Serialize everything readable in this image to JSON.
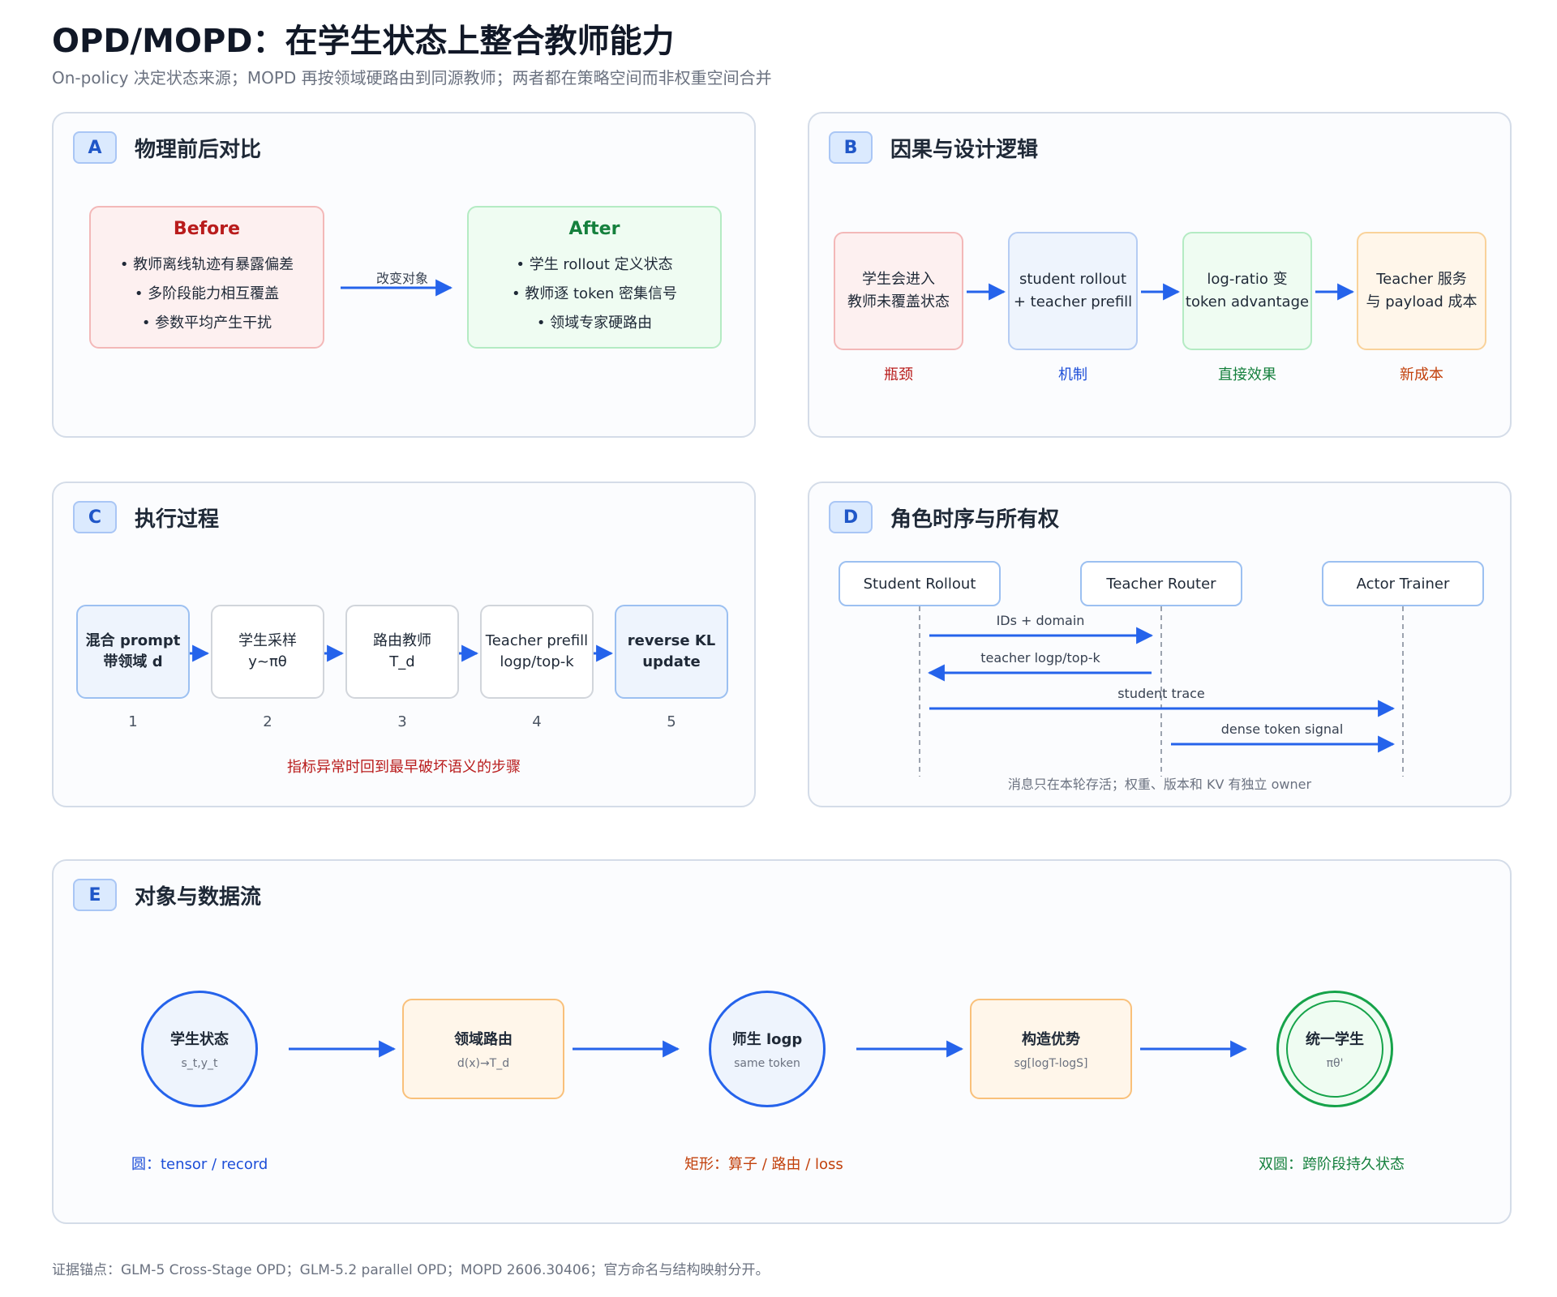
{
  "header": {
    "title": "OPD/MOPD：在学生状态上整合教师能力",
    "subtitle": "On-policy 决定状态来源；MOPD 再按领域硬路由到同源教师；两者都在策略空间而非权重空间合并"
  },
  "panelA": {
    "badge": "A",
    "title": "物理前后对比",
    "before": {
      "title": "Before",
      "items": [
        "• 教师离线轨迹有暴露偏差",
        "• 多阶段能力相互覆盖",
        "• 参数平均产生干扰"
      ]
    },
    "arrow_label": "改变对象",
    "after": {
      "title": "After",
      "items": [
        "• 学生 rollout 定义状态",
        "• 教师逐 token 密集信号",
        "• 领域专家硬路由"
      ]
    }
  },
  "panelB": {
    "badge": "B",
    "title": "因果与设计逻辑",
    "steps": [
      {
        "lines": [
          "学生会进入",
          "教师未覆盖状态"
        ],
        "caption": "瓶颈"
      },
      {
        "lines": [
          "student rollout",
          "+ teacher prefill"
        ],
        "caption": "机制"
      },
      {
        "lines": [
          "log-ratio 变",
          "token advantage"
        ],
        "caption": "直接效果"
      },
      {
        "lines": [
          "Teacher 服务",
          "与 payload 成本"
        ],
        "caption": "新成本"
      }
    ]
  },
  "panelC": {
    "badge": "C",
    "title": "执行过程",
    "steps": [
      {
        "lines": [
          "混合 prompt",
          "带领域 d"
        ],
        "num": "1"
      },
      {
        "lines": [
          "学生采样",
          "y~πθ"
        ],
        "num": "2"
      },
      {
        "lines": [
          "路由教师",
          "T_d"
        ],
        "num": "3"
      },
      {
        "lines": [
          "Teacher prefill",
          "logp/top-k"
        ],
        "num": "4"
      },
      {
        "lines": [
          "reverse KL",
          "update"
        ],
        "num": "5"
      }
    ],
    "note": "指标异常时回到最早破坏语义的步骤"
  },
  "panelD": {
    "badge": "D",
    "title": "角色时序与所有权",
    "actors": [
      "Student Rollout",
      "Teacher Router",
      "Actor Trainer"
    ],
    "messages": [
      "IDs + domain",
      "teacher logp/top-k",
      "student trace",
      "dense token signal"
    ],
    "note": "消息只在本轮存活；权重、版本和 KV 有独立 owner"
  },
  "panelE": {
    "badge": "E",
    "title": "对象与数据流",
    "nodes": [
      {
        "title": "学生状态",
        "sub": "s_t,y_t"
      },
      {
        "title": "领域路由",
        "sub": "d(x)→T_d"
      },
      {
        "title": "师生 logp",
        "sub": "same token"
      },
      {
        "title": "构造优势",
        "sub": "sg[logT-logS]"
      },
      {
        "title": "统一学生",
        "sub": "πθ'"
      }
    ],
    "legend": [
      "圆：tensor / record",
      "矩形：算子 / 路由 / loss",
      "双圆：跨阶段持久状态"
    ]
  },
  "footer": "证据锚点：GLM-5 Cross-Stage OPD；GLM-5.2 parallel OPD；MOPD 2606.30406；官方命名与结构映射分开。",
  "colors": {
    "accent_blue": "#2563eb",
    "red": "#b91c1c",
    "green": "#15803d",
    "orange": "#c2410c"
  }
}
